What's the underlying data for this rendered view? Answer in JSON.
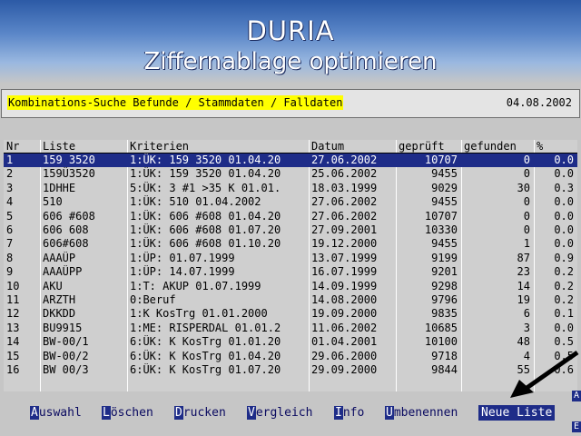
{
  "header": {
    "title": "DURIA",
    "subtitle": "Ziffernablage optimieren"
  },
  "search": {
    "text": "Kombinations-Suche Befunde / Stammdaten / Falldaten",
    "date": "04.08.2002"
  },
  "table": {
    "columns": [
      "Nr",
      "Liste",
      "Kriterien",
      "Datum",
      "geprüft",
      "gefunden",
      "%"
    ],
    "rows": [
      [
        "1",
        "159 3520",
        "1:ÜK: 159 3520 01.04.20",
        "27.06.2002",
        "10707",
        "0",
        "0.0"
      ],
      [
        "2",
        "159Ü3520",
        "1:ÜK: 159 3520 01.04.20",
        "25.06.2002",
        "9455",
        "0",
        "0.0"
      ],
      [
        "3",
        "1DHHE",
        "5:ÜK: 3 #1 >35 K 01.01.",
        "18.03.1999",
        "9029",
        "30",
        "0.3"
      ],
      [
        "4",
        "510",
        "1:ÜK: 510 01.04.2002",
        "27.06.2002",
        "9455",
        "0",
        "0.0"
      ],
      [
        "5",
        "606 #608",
        "1:ÜK: 606 #608 01.04.20",
        "27.06.2002",
        "10707",
        "0",
        "0.0"
      ],
      [
        "6",
        "606 608",
        "1:ÜK: 606 #608 01.07.20",
        "27.09.2001",
        "10330",
        "0",
        "0.0"
      ],
      [
        "7",
        "606#608",
        "1:ÜK: 606 #608 01.10.20",
        "19.12.2000",
        "9455",
        "1",
        "0.0"
      ],
      [
        "8",
        "AAAÜP",
        "1:ÜP: 01.07.1999",
        "13.07.1999",
        "9199",
        "87",
        "0.9"
      ],
      [
        "9",
        "AAAÜPP",
        "1:ÜP: 14.07.1999",
        "16.07.1999",
        "9201",
        "23",
        "0.2"
      ],
      [
        "10",
        "AKU",
        "1:T: AKUP 01.07.1999",
        "14.09.1999",
        "9298",
        "14",
        "0.2"
      ],
      [
        "11",
        "ARZTH",
        "0:Beruf",
        "14.08.2000",
        "9796",
        "19",
        "0.2"
      ],
      [
        "12",
        "DKKDD",
        "1:K KosTrg 01.01.2000",
        "19.09.2000",
        "9835",
        "6",
        "0.1"
      ],
      [
        "13",
        "BU9915",
        "1:ME: RISPERDAL 01.01.2",
        "11.06.2002",
        "10685",
        "3",
        "0.0"
      ],
      [
        "14",
        "BW-00/1",
        "6:ÜK: K KosTrg 01.01.20",
        "01.04.2001",
        "10100",
        "48",
        "0.5"
      ],
      [
        "15",
        "BW-00/2",
        "6:ÜK: K KosTrg 01.04.20",
        "29.06.2000",
        "9718",
        "4",
        "0.5"
      ],
      [
        "16",
        "BW 00/3",
        "6:ÜK: K KosTrg 01.07.20",
        "29.09.2000",
        "9844",
        "55",
        "0.6"
      ]
    ],
    "selected_row": 1
  },
  "actions": [
    {
      "hotkey": "A",
      "rest": "uswahl"
    },
    {
      "hotkey": "L",
      "rest": "öschen"
    },
    {
      "hotkey": "D",
      "rest": "rucken"
    },
    {
      "hotkey": "V",
      "rest": "ergleich"
    },
    {
      "hotkey": "I",
      "rest": "nfo"
    },
    {
      "hotkey": "U",
      "rest": "mbenennen"
    },
    {
      "hotkey": "",
      "rest": "Neue Liste"
    }
  ],
  "edge_marks": [
    "A",
    "E"
  ],
  "colors": {
    "selection": "#1e2c88",
    "highlight": "#ffff00",
    "background": "#c6c6c6"
  },
  "icons": [
    "arrow-pointer-icon"
  ]
}
